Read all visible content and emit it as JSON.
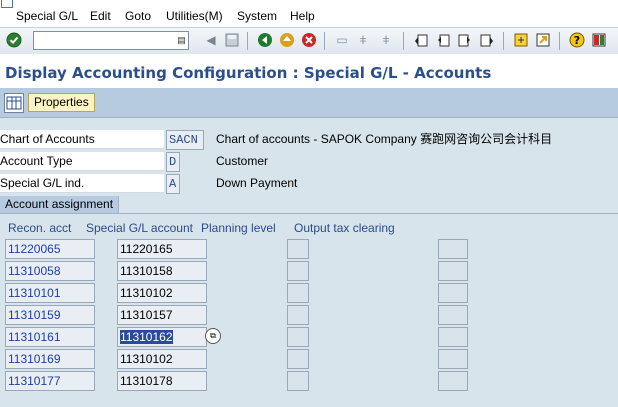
{
  "menu": {
    "items": [
      "Special G/L",
      "Edit",
      "Goto",
      "Utilities(M)",
      "System",
      "Help"
    ]
  },
  "toolbar": {
    "command_value": "",
    "icons": [
      "enter-icon",
      "history-icon",
      "back-nav-icon",
      "save-icon",
      "back-icon",
      "exit-icon",
      "cancel-icon",
      "print-icon",
      "find-icon",
      "find-next-icon",
      "first-page-icon",
      "previous-page-icon",
      "next-page-icon",
      "last-page-icon",
      "create-session-icon",
      "shortcut-icon",
      "help-icon",
      "customize-layout-icon"
    ]
  },
  "title": "Display Accounting Configuration : Special G/L - Accounts",
  "app_toolbar": {
    "properties_label": "Properties"
  },
  "header": {
    "chart_of_accounts": {
      "label": "Chart of Accounts",
      "value": "SACN",
      "desc": "Chart of accounts - SAPOK Company 赛跑网咨询公司会计科目"
    },
    "account_type": {
      "label": "Account Type",
      "value": "D",
      "desc": "Customer"
    },
    "special_gl_ind": {
      "label": "Special G/L ind.",
      "value": "A",
      "desc": "Down Payment"
    }
  },
  "section": {
    "tab_label": "Account assignment",
    "columns": [
      "Recon. acct",
      "Special G/L account",
      "Planning level",
      "Output tax clearing"
    ],
    "rows": [
      {
        "recon": "11220065",
        "sgl": "11220165"
      },
      {
        "recon": "11310058",
        "sgl": "11310158"
      },
      {
        "recon": "11310101",
        "sgl": "11310102"
      },
      {
        "recon": "11310159",
        "sgl": "11310157"
      },
      {
        "recon": "11310161",
        "sgl": "11310162"
      },
      {
        "recon": "11310169",
        "sgl": "11310102"
      },
      {
        "recon": "11310177",
        "sgl": "11310178"
      }
    ]
  },
  "colors": {
    "title": "#2b4e8c",
    "selection": "#2a4a9c",
    "link_blue": "#1f3fa0",
    "properties_bg": "#fbf3c6"
  }
}
